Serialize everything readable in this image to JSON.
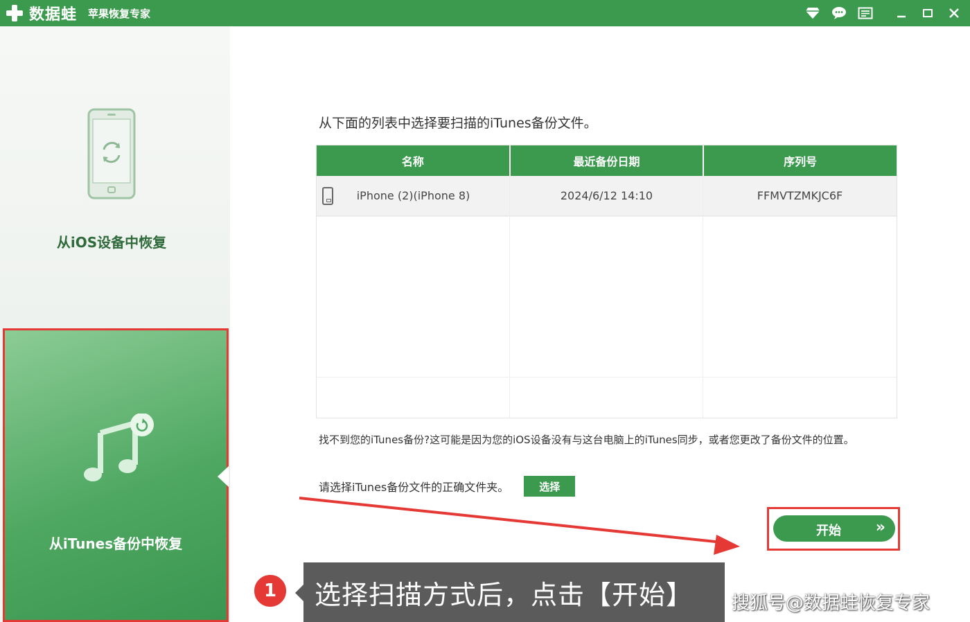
{
  "titlebar": {
    "app_name": "数据蛙",
    "app_subtitle": "苹果恢复专家",
    "icons": [
      "diamond-icon",
      "chat-icon",
      "menu-icon",
      "minimize-icon",
      "maximize-icon",
      "close-icon"
    ],
    "bg_color": "#3b9a4d"
  },
  "sidebar": {
    "ios_label": "从iOS设备中恢复",
    "itunes_label": "从iTunes备份中恢复"
  },
  "main": {
    "instruction": "从下面的列表中选择要扫描的iTunes备份文件。",
    "table": {
      "headers": [
        "名称",
        "最近备份日期",
        "序列号"
      ],
      "rows": [
        {
          "name": "iPhone (2)(iPhone 8)",
          "date": "2024/6/12 14:10",
          "serial": "FFMVTZMKJC6F"
        }
      ]
    },
    "hint": "找不到您的iTunes备份?这可能是因为您的iOS设备没有与这台电脑上的iTunes同步，或者您更改了备份文件的位置。",
    "choose_text": "请选择iTunes备份文件的正确文件夹。",
    "choose_button": "选择",
    "start_button": "开始",
    "start_chevron": "»"
  },
  "annotation": {
    "step_number": "1",
    "callout_text": "选择扫描方式后，点击【开始】",
    "highlight_color": "#e53935"
  },
  "watermark": "搜狐号@数据蛙恢复专家"
}
